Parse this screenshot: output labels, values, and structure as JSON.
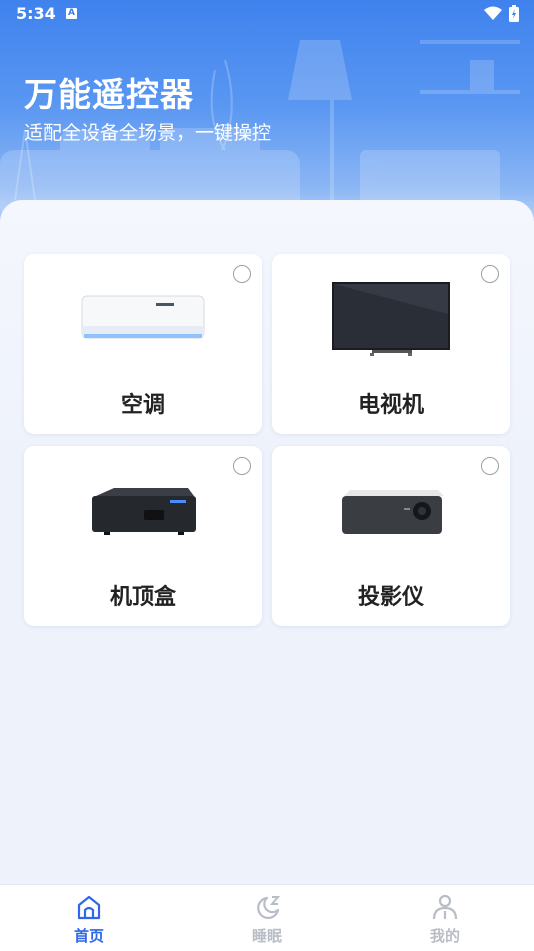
{
  "status_bar": {
    "time": "5:34",
    "notification_badge": "A"
  },
  "header": {
    "title": "万能遥控器",
    "subtitle": "适配全设备全场景，一键操控"
  },
  "devices": [
    {
      "label": "空调",
      "icon": "air-conditioner-image",
      "selected": false
    },
    {
      "label": "电视机",
      "icon": "television-image",
      "selected": false
    },
    {
      "label": "机顶盒",
      "icon": "set-top-box-image",
      "selected": false
    },
    {
      "label": "投影仪",
      "icon": "projector-image",
      "selected": false
    }
  ],
  "tabs": [
    {
      "label": "首页",
      "icon": "home-icon",
      "active": true
    },
    {
      "label": "睡眠",
      "icon": "moon-sleep-icon",
      "active": false
    },
    {
      "label": "我的",
      "icon": "profile-icon",
      "active": false
    }
  ],
  "colors": {
    "accent": "#2f67e8",
    "hero_top": "#3f82ee",
    "background": "#eef2fb",
    "inactive_tab": "#b9bdc6"
  }
}
